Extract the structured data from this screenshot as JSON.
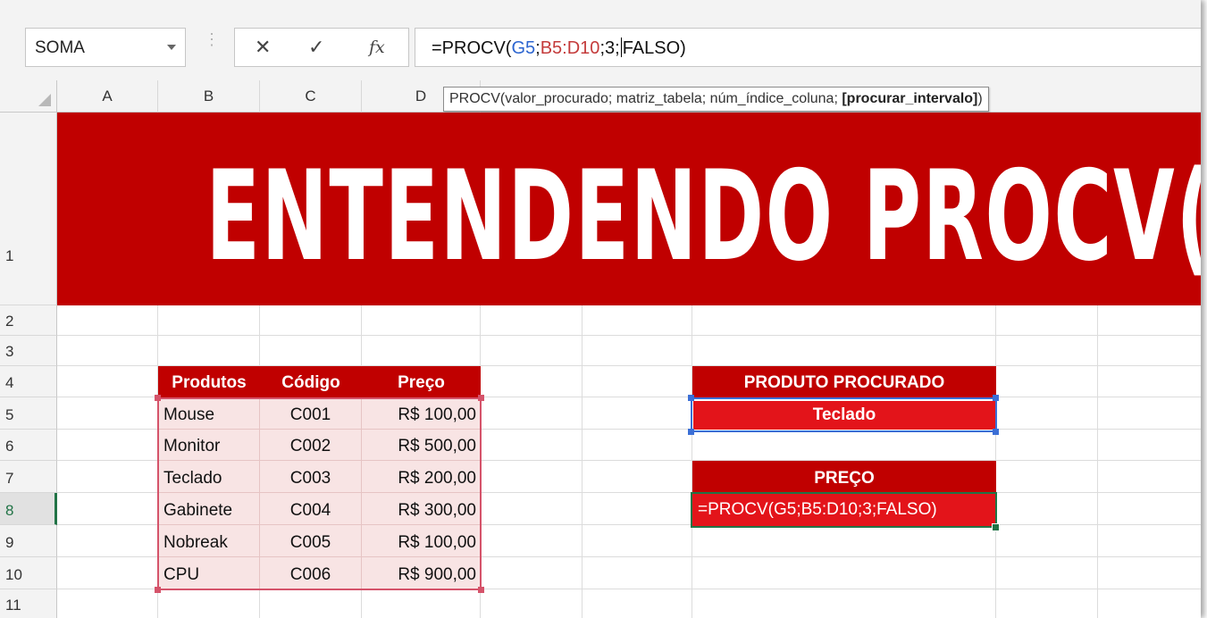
{
  "formula_bar": {
    "name_box": "SOMA",
    "cancel_icon": "✕",
    "enter_icon": "✓",
    "fx_label": "fx",
    "formula_prefix": "=PROCV(",
    "formula_ref1": "G5",
    "formula_sep1": ";",
    "formula_ref2": "B5:D10",
    "formula_mid": ";3;",
    "formula_suffix": "FALSO)"
  },
  "tooltip": {
    "text": "PROCV(valor_procurado; matriz_tabela; núm_índice_coluna; ",
    "bold": "[procurar_intervalo]",
    "end": ")"
  },
  "columns": [
    "A",
    "B",
    "C",
    "D"
  ],
  "rows": [
    "1",
    "2",
    "3",
    "4",
    "5",
    "6",
    "7",
    "8",
    "9",
    "10",
    "11"
  ],
  "active_row": "8",
  "banner": {
    "title": "ENTENDENDO PROCV()"
  },
  "table": {
    "headers": [
      "Produtos",
      "Código",
      "Preço"
    ],
    "rows": [
      [
        "Mouse",
        "C001",
        "R$ 100,00"
      ],
      [
        "Monitor",
        "C002",
        "R$ 500,00"
      ],
      [
        "Teclado",
        "C003",
        "R$ 200,00"
      ],
      [
        "Gabinete",
        "C004",
        "R$ 300,00"
      ],
      [
        "Nobreak",
        "C005",
        "R$ 100,00"
      ],
      [
        "CPU",
        "C006",
        "R$ 900,00"
      ]
    ]
  },
  "lookup": {
    "header": "PRODUTO  PROCURADO",
    "value": "Teclado",
    "price_header": "PREÇO",
    "price_formula": "=PROCV(G5;B5:D10;3;FALSO)"
  },
  "colors": {
    "accent_red": "#c00000",
    "bright_red": "#e3141a",
    "excel_green": "#217346",
    "ref_blue": "#2c65d0"
  }
}
